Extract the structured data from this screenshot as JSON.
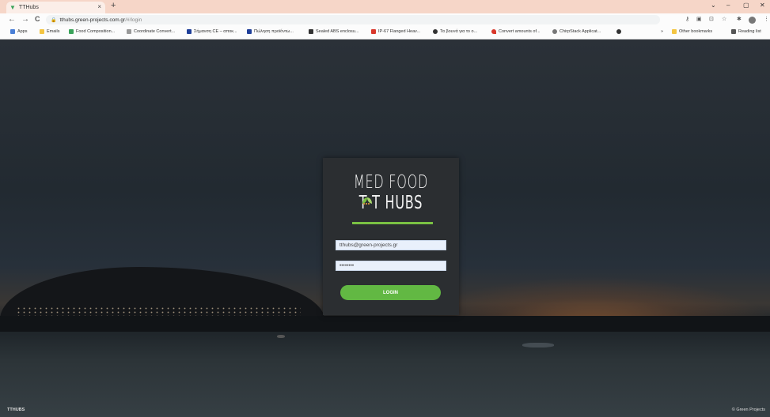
{
  "browser": {
    "tab_title": "TTHubs",
    "tab_close": "×",
    "new_tab": "+",
    "win_min": "⌄",
    "win_min2": "–",
    "win_max": "▢",
    "win_close": "✕",
    "url_host": "tthubs.green-projects.com.gr",
    "url_path": "/#/login",
    "back": "←",
    "forward": "→",
    "reload": "C"
  },
  "bookmarks": {
    "items": [
      {
        "label": "Apps",
        "color": "#4a7fd6"
      },
      {
        "label": "Emails",
        "color": "#f4c542"
      },
      {
        "label": "Food Composition...",
        "color": "#3aa35a"
      },
      {
        "label": "Coordinate Convert...",
        "color": "#999999"
      },
      {
        "label": "Σήμανση CE – αποκ...",
        "color": "#1f3f99"
      },
      {
        "label": "Πώληση προϊόντω...",
        "color": "#1f3f99"
      },
      {
        "label": "Sealed ABS enclosu...",
        "color": "#333333"
      },
      {
        "label": "IP-67 Flanged Heav...",
        "color": "#d9372b"
      },
      {
        "label": "Τα βουνά για το ο...",
        "color": "#333333"
      },
      {
        "label": "Convert amounts of...",
        "color": "#d9372b"
      },
      {
        "label": "ChirpStack Applicat...",
        "color": "#777777"
      }
    ],
    "more": "»",
    "other": "Other bookmarks",
    "reading": "Reading list"
  },
  "login": {
    "logo_line1": "MED FOOD",
    "logo_line2": "T  T HUBS",
    "email_value": "tthubs@green-projects.gr",
    "password_value": "••••••••",
    "button_label": "LOGIN"
  },
  "footer": {
    "left": "TTHUBS",
    "right": "© Green Projects"
  },
  "colors": {
    "accent": "#62b843"
  }
}
